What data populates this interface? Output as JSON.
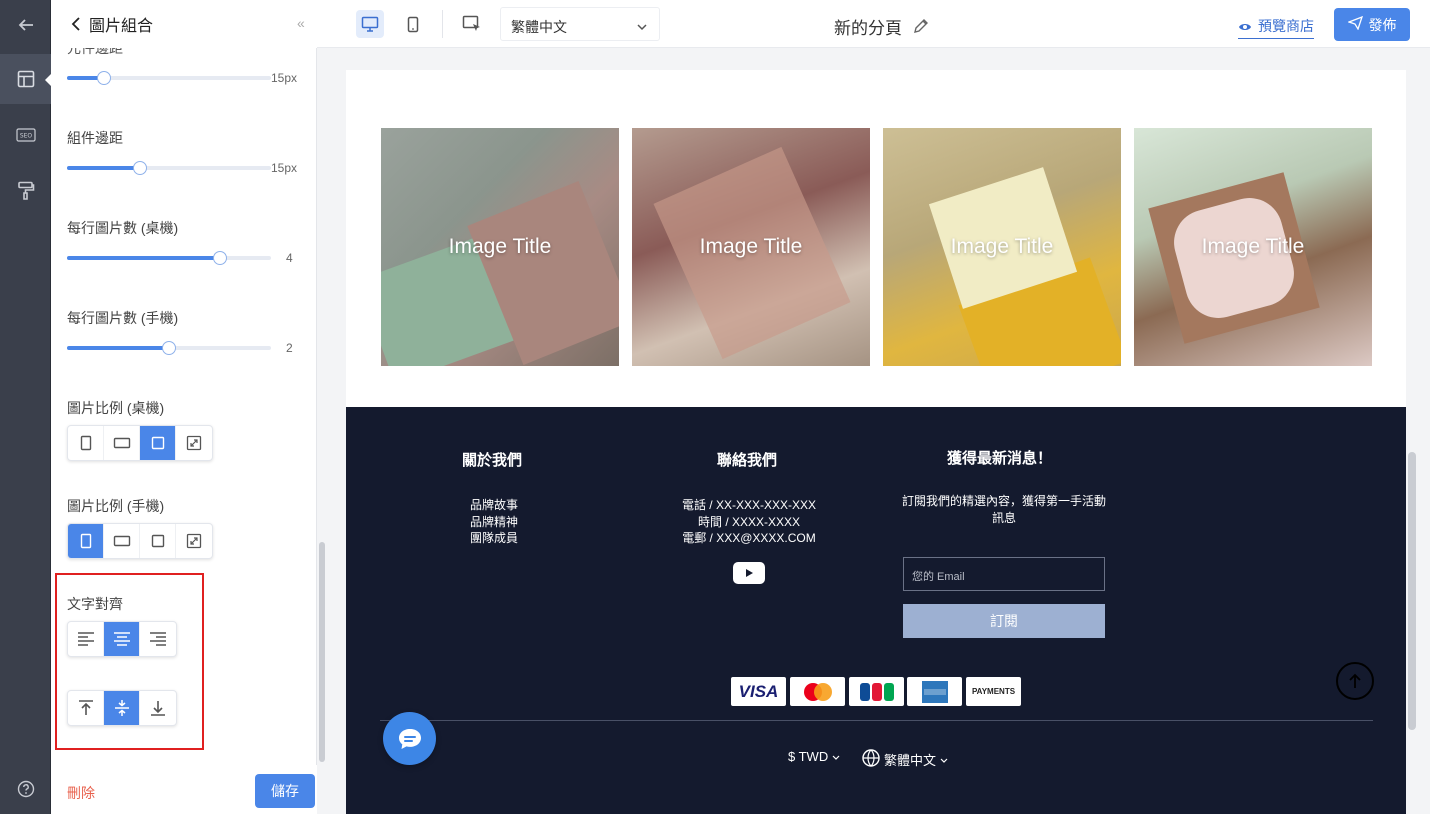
{
  "panel": {
    "title": "圖片組合",
    "partial_label": "元件邊距",
    "sliders": [
      {
        "label": "組件邊距",
        "value": "15px",
        "fraction": 0.36
      },
      {
        "label": "每行圖片數 (桌機)",
        "value": "4",
        "fraction": 0.75
      },
      {
        "label": "每行圖片數 (手機)",
        "value": "2",
        "fraction": 0.5
      }
    ],
    "top_slider": {
      "value": "15px",
      "fraction": 0.18
    },
    "ratio_desktop_label": "圖片比例 (桌機)",
    "ratio_mobile_label": "圖片比例 (手機)",
    "text_align_label": "文字對齊",
    "delete_label": "刪除",
    "save_label": "儲存"
  },
  "topbar": {
    "language": "繁體中文",
    "page_title": "新的分頁",
    "preview_label": "預覽商店",
    "publish_label": "發佈"
  },
  "gallery": {
    "items": [
      {
        "title": "Image Title"
      },
      {
        "title": "Image Title"
      },
      {
        "title": "Image Title"
      },
      {
        "title": "Image Title"
      }
    ]
  },
  "footer": {
    "about_heading": "關於我們",
    "about_links": [
      "品牌故事",
      "品牌精神",
      "團隊成員"
    ],
    "contact_heading": "聯絡我們",
    "contact_lines": [
      "電話 / XX-XXX-XXX-XXX",
      "時間 / XXXX-XXXX",
      "電郵 / XXX@XXXX.COM"
    ],
    "news_heading": "獲得最新消息！",
    "news_text": "訂閱我們的精選內容，獲得第一手活動訊息",
    "email_placeholder": "您的 Email",
    "subscribe_label": "訂閱",
    "payments": [
      "VISA",
      "Mastercard",
      "JCB",
      "American Express",
      "PAYMENTS"
    ],
    "currency": "$ TWD",
    "language": "繁體中文"
  },
  "colors": {
    "accent": "#4a86e8",
    "footer_bg": "#141a2e",
    "rail_bg": "#3a3f4b",
    "highlight": "#e02020"
  }
}
